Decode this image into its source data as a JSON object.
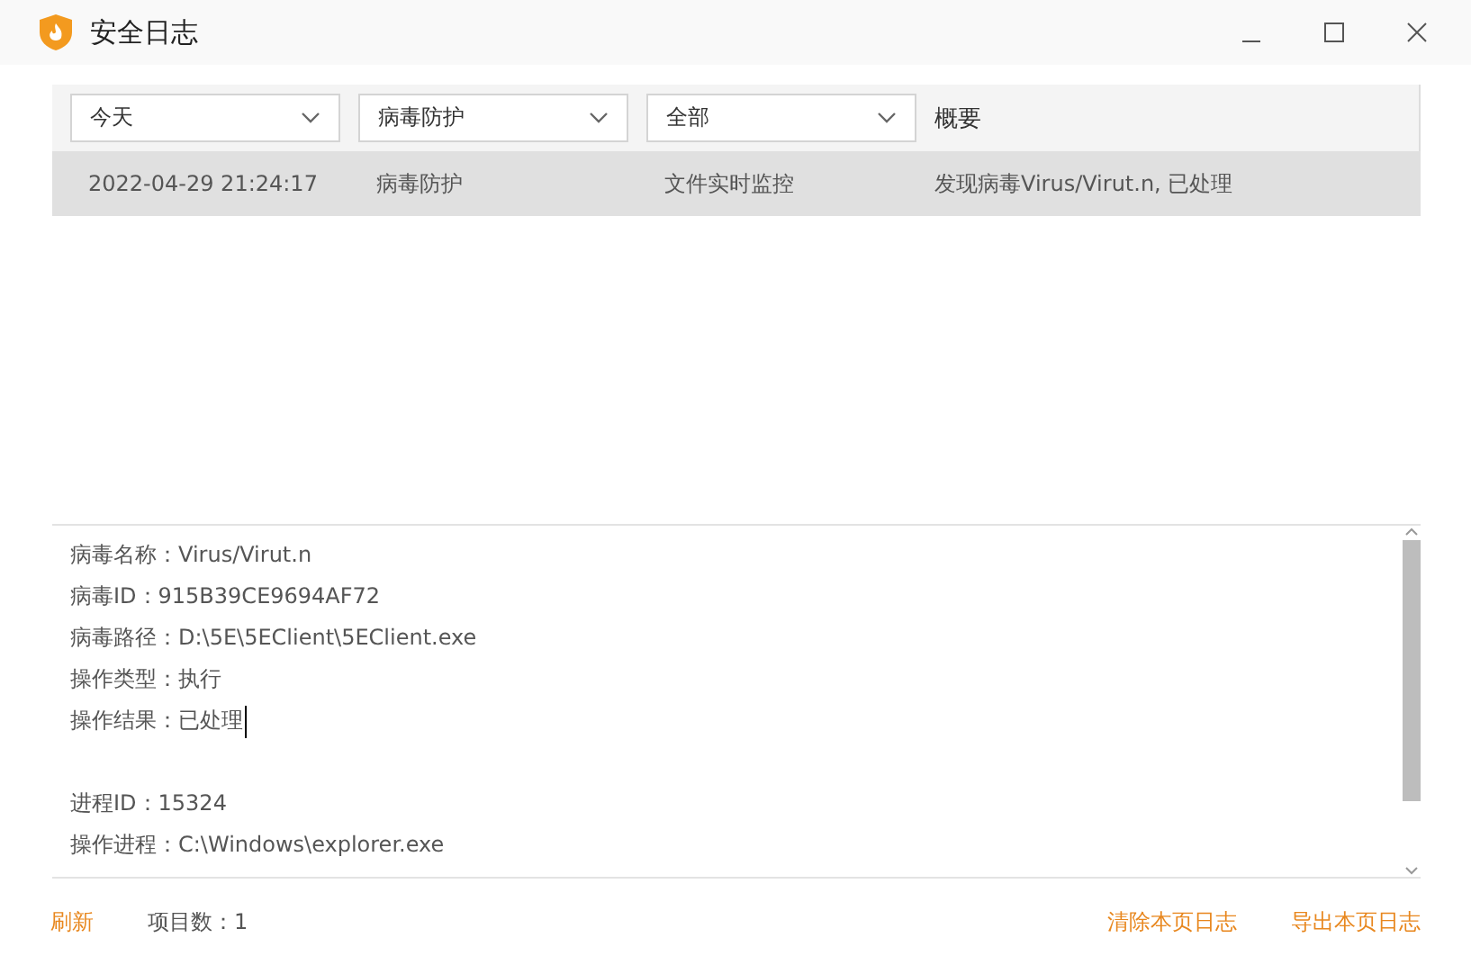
{
  "window": {
    "title": "安全日志"
  },
  "filters": [
    {
      "value": "今天"
    },
    {
      "value": "病毒防护"
    },
    {
      "value": "全部"
    }
  ],
  "summary_header": "概要",
  "rows": [
    {
      "selected": true,
      "cells": [
        "2022-04-29 21:24:17",
        "病毒防护",
        "文件实时监控",
        "发现病毒Virus/Virut.n, 已处理"
      ]
    }
  ],
  "details": [
    {
      "text": "病毒名称：Virus/Virut.n"
    },
    {
      "text": "病毒ID：915B39CE9694AF72"
    },
    {
      "text": "病毒路径：D:\\5E\\5EClient\\5EClient.exe"
    },
    {
      "text": "操作类型：执行"
    },
    {
      "text": "操作结果：已处理"
    },
    {
      "text": "进程ID：15324"
    },
    {
      "text": "操作进程：C:\\Windows\\explorer.exe"
    }
  ],
  "footer": {
    "refresh": "刷新",
    "count": "项目数：1",
    "clear": "清除本页日志",
    "export": "导出本页日志"
  }
}
